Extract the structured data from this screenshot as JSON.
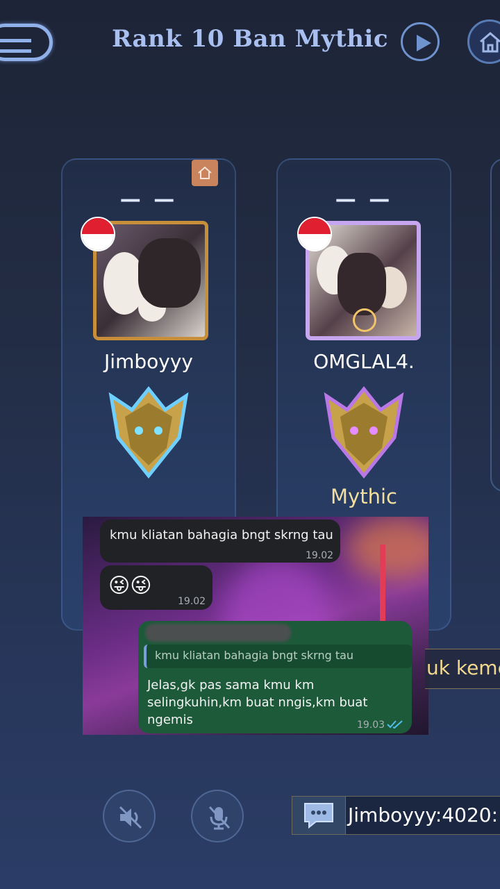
{
  "header": {
    "title": "Rank 10 Ban Mythic"
  },
  "players": [
    {
      "slot": "— —",
      "name": "Jimboyyy",
      "rank": ""
    },
    {
      "slot": "— —",
      "name": "OMGLAL4.",
      "rank": "Mythic"
    }
  ],
  "chat_overlay": {
    "messages": [
      {
        "text": "kmu kliatan bahagia bngt skrng tau",
        "time": "19.02"
      },
      {
        "text": "😜😜",
        "time": "19.02"
      }
    ],
    "reply": {
      "quoted": "kmu kliatan bahagia bngt skrng tau",
      "text": "Jelas,gk pas sama kmu km selingkuhin,km buat nngis,km buat ngemis",
      "time": "19.03"
    }
  },
  "side_ticker": {
    "text": "uk keme"
  },
  "bottom_bar": {
    "chat_preview": "Jimboyyy:4020:"
  },
  "colors": {
    "title": "#a8bff0",
    "rank_label": "#f2dfa0",
    "whatsapp_out": "#1c5a3a",
    "whatsapp_in": "#202225",
    "read_ticks": "#53bdeb"
  },
  "icons": [
    "back-icon",
    "play-icon",
    "home-icon",
    "room-owner-icon",
    "flag-indonesia-icon",
    "mythic-emblem-icon",
    "speaker-muted-icon",
    "mic-muted-icon",
    "chat-icon",
    "double-check-icon"
  ]
}
